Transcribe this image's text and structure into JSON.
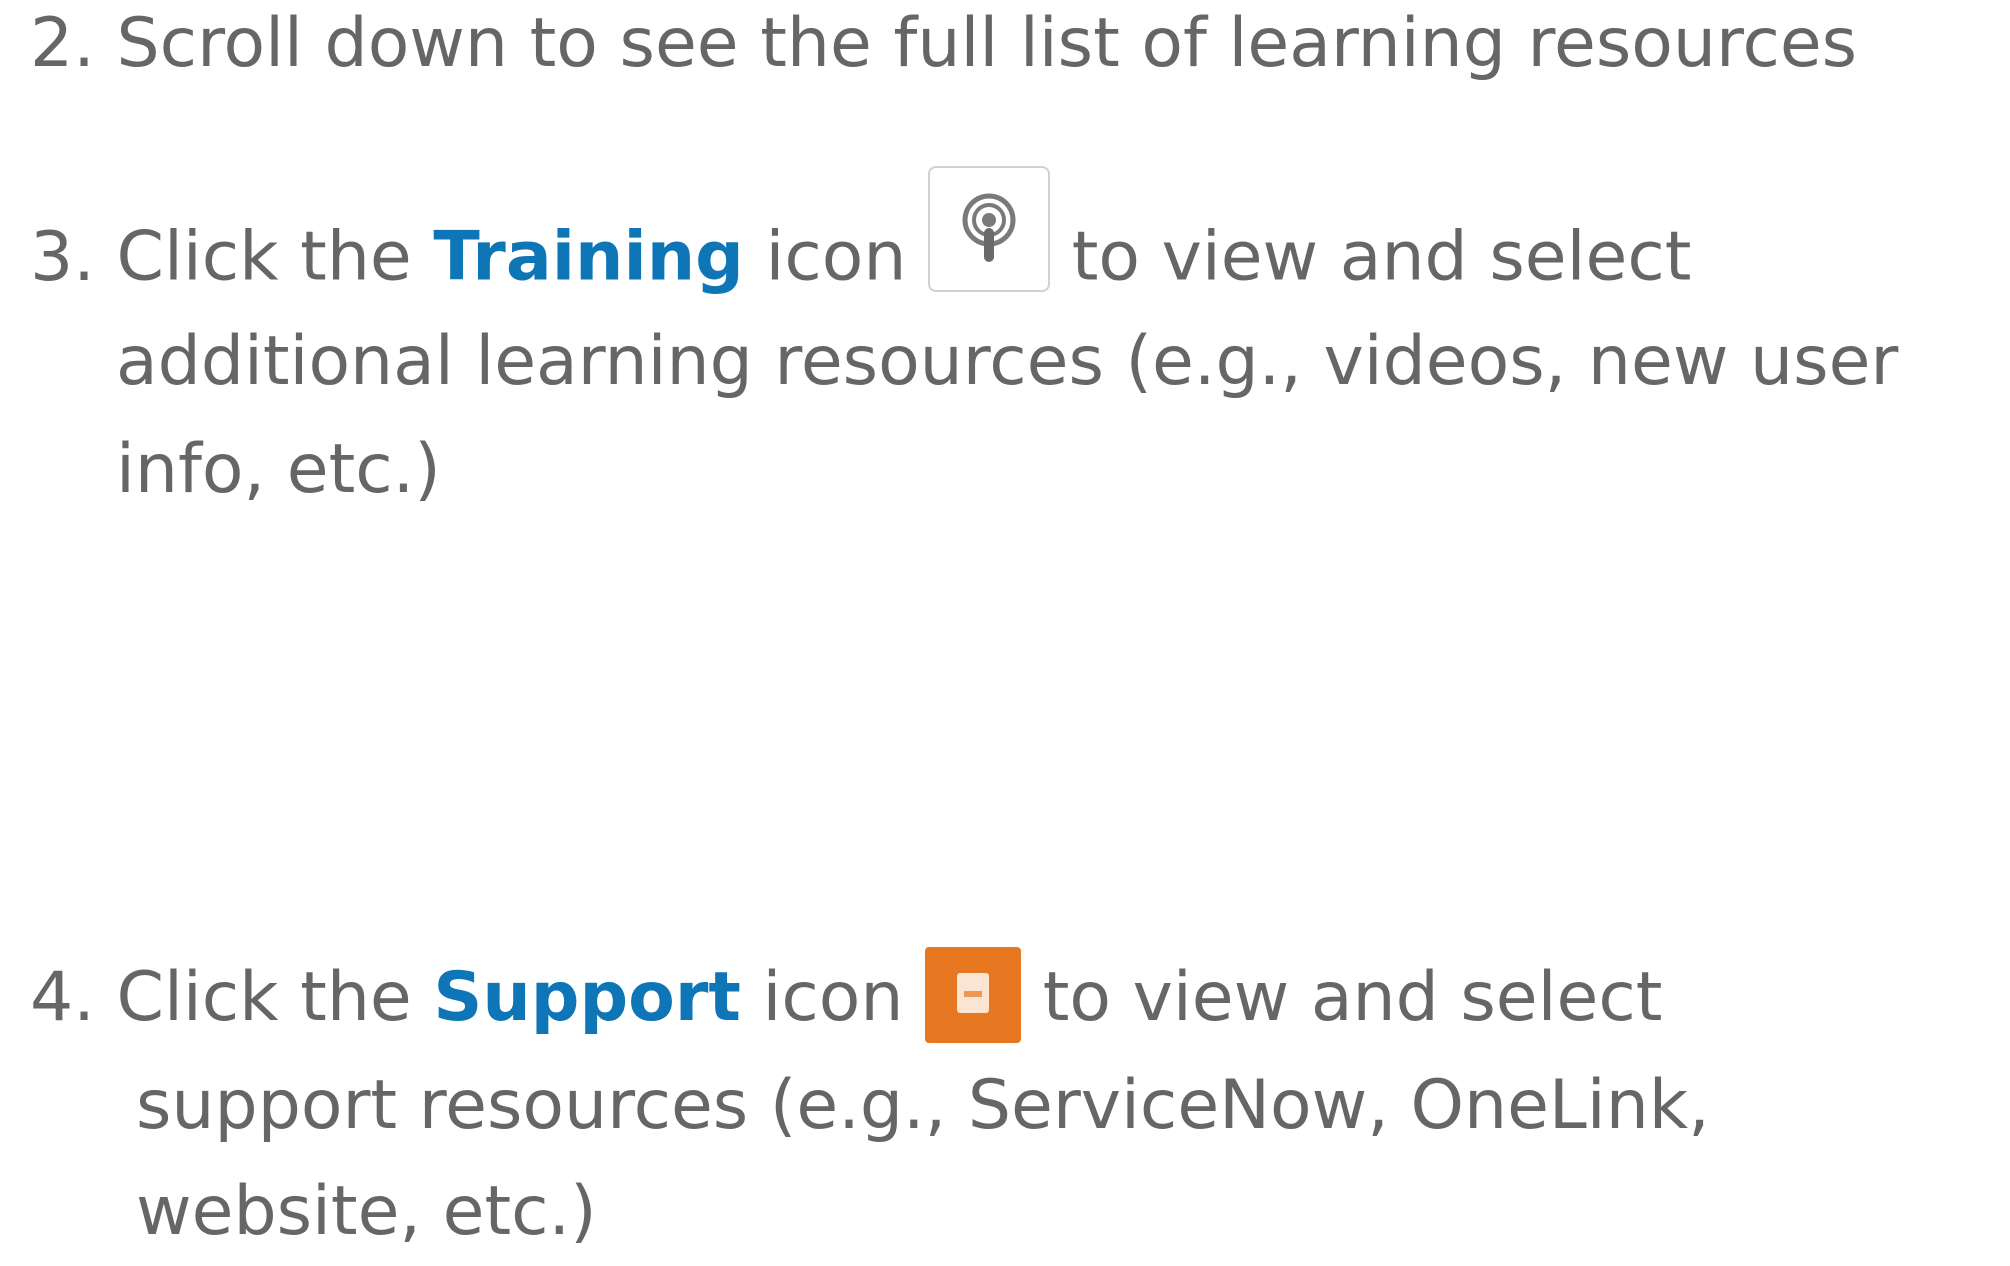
{
  "steps": [
    {
      "number": "2.",
      "lines": [
        "Scroll down to see the full list of learning resources"
      ]
    },
    {
      "number": "3.",
      "prefix": "Click the",
      "keyword": "Training",
      "icon_word": "icon",
      "icon": "podcast-icon",
      "suffix": "to view and select",
      "continuation": [
        "additional learning resources (e.g., videos, new user",
        "info, etc.)"
      ]
    },
    {
      "number": "4.",
      "prefix": "Click the",
      "keyword": "Support",
      "icon_word": "icon",
      "icon": "document-icon",
      "suffix": "to view and select",
      "continuation": [
        "support resources (e.g., ServiceNow, OneLink,",
        "website, etc.)"
      ]
    }
  ],
  "colors": {
    "text": "#666666",
    "keyword": "#0e75b6",
    "support_icon_bg": "#e87722"
  }
}
